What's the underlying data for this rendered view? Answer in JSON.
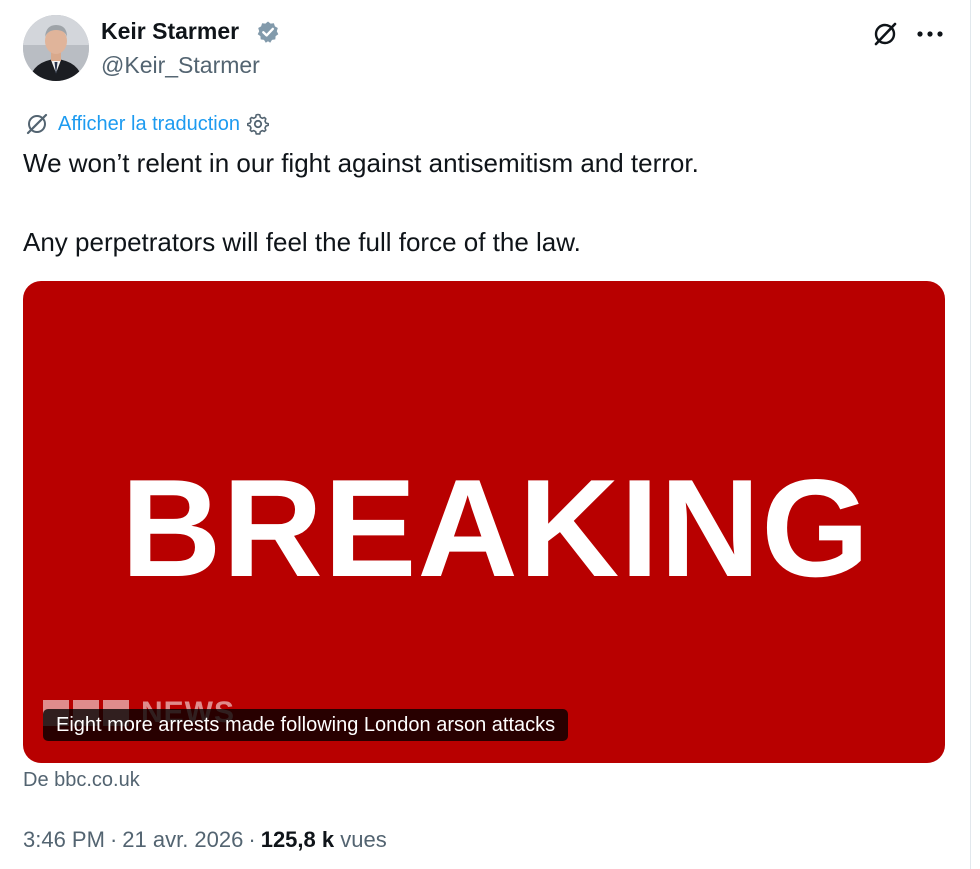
{
  "author": {
    "name": "Keir Starmer",
    "handle": "@Keir_Starmer",
    "verified": true
  },
  "icons": {
    "avatar": "profile-photo",
    "verified": "verified-badge-icon",
    "grok": "grok-icon",
    "more": "more-horizontal-icon",
    "translate": "grok-translate-icon",
    "settings": "gear-icon"
  },
  "translate": {
    "label": "Afficher la traduction"
  },
  "tweet": {
    "line1": "We won’t relent in our fight against antisemitism and terror.",
    "line2": "Any perpetrators will feel the full force of the law."
  },
  "card": {
    "image_text": "BREAKING",
    "logo_text": "NEWS",
    "caption": "Eight more arrests made following London arson attacks",
    "source": "De bbc.co.uk",
    "background_color": "#b80000"
  },
  "meta": {
    "time": "3:46 PM",
    "date": "21 avr. 2026",
    "separator": "·",
    "views_count": "125,8 k",
    "views_label": "vues"
  },
  "colors": {
    "text": "#0f1419",
    "secondary": "#536471",
    "link": "#1d9bf0",
    "verified": "#829aab"
  }
}
